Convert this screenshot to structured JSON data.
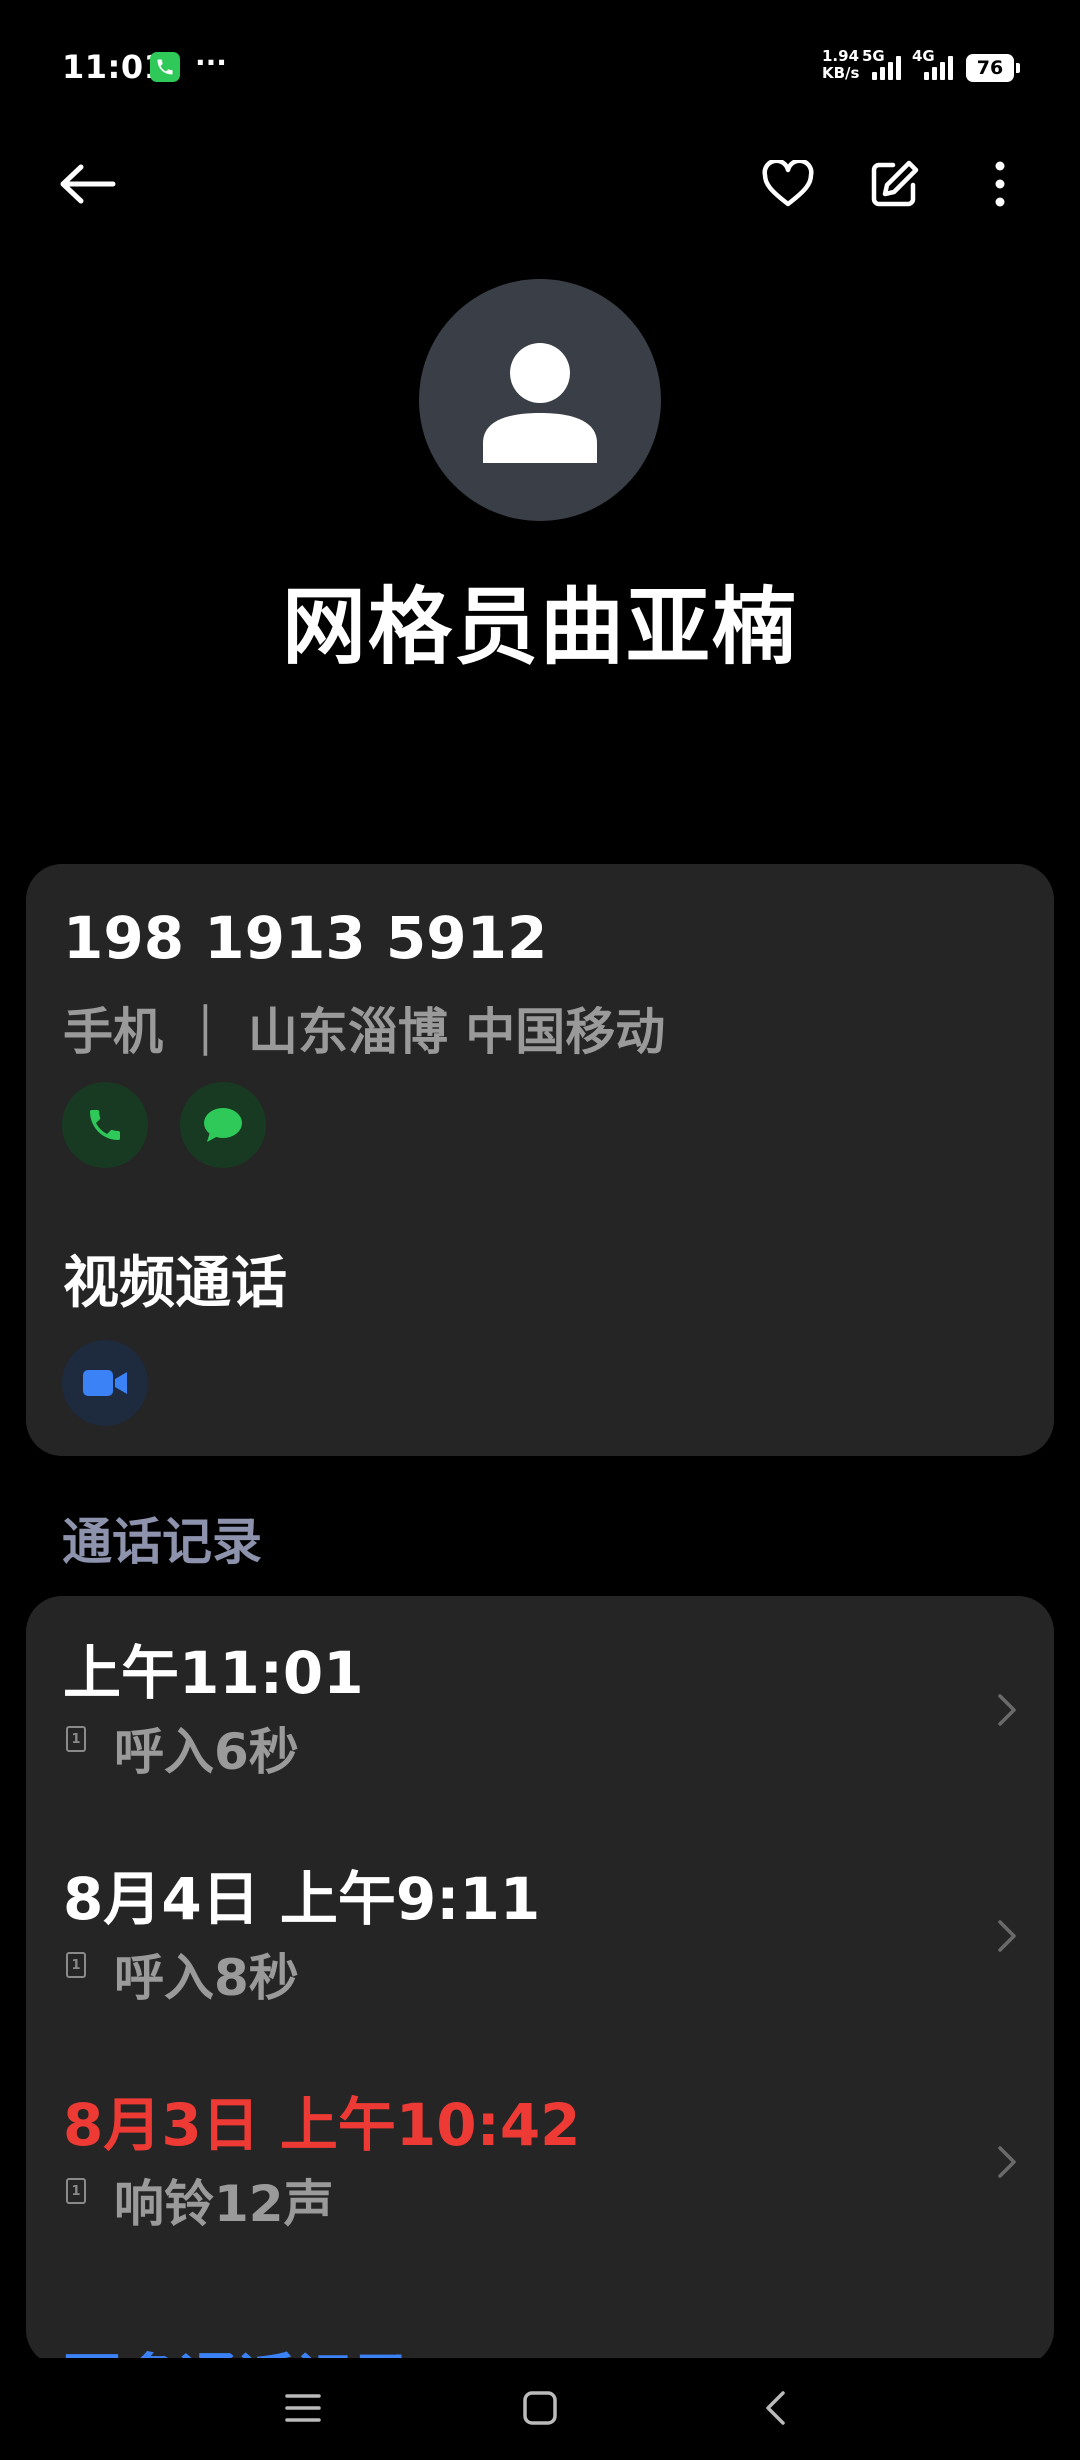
{
  "status_bar": {
    "time": "11:01",
    "dots": "···",
    "speed_value": "1.94",
    "speed_unit": "KB/s",
    "net1": "5G",
    "net2": "4G",
    "battery": "76"
  },
  "contact": {
    "name": "网格员曲亚楠"
  },
  "phone_card": {
    "number": "198 1913 5912",
    "meta": "手机 ｜ 山东淄博 中国移动",
    "video_title": "视频通话"
  },
  "call_log": {
    "section_title": "通话记录",
    "sim_label": "1",
    "entries": [
      {
        "time": "上午11:01",
        "detail": "呼入6秒",
        "missed": false
      },
      {
        "time": "8月4日 上午9:11",
        "detail": "呼入8秒",
        "missed": false
      },
      {
        "time": "8月3日 上午10:42",
        "detail": "响铃12声",
        "missed": true
      }
    ],
    "more_label": "更多通话记录"
  },
  "next_section_peek": "更多",
  "colors": {
    "accent_blue": "#3b82f6",
    "missed_red": "#ee3a34",
    "call_green": "#2fc95a",
    "card_bg": "#252525"
  },
  "icons": {
    "back": "arrow-left-icon",
    "favorite": "heart-icon",
    "edit": "edit-icon",
    "more": "more-vertical-icon",
    "call": "phone-icon",
    "message": "message-icon",
    "video": "video-camera-icon",
    "chevron": "chevron-right-icon"
  }
}
